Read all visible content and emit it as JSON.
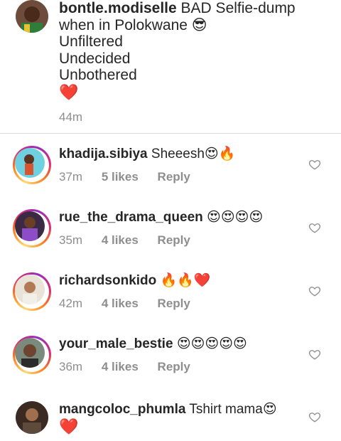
{
  "post": {
    "username": "bontle.modiselle",
    "caption_first": "BAD Selfie-dump",
    "caption_second": "when in Polokwane",
    "caption_second_emoji": "😎",
    "lines": [
      "Unfiltered",
      "Undecided",
      "Unbothered"
    ],
    "heart": "❤️",
    "time": "44m"
  },
  "comments": [
    {
      "username": "khadija.sibiya",
      "text": "Sheeesh",
      "emoji": "😍🔥",
      "time": "37m",
      "likes": "5 likes",
      "reply": "Reply"
    },
    {
      "username": "rue_the_drama_queen",
      "text": "",
      "emoji": "😍😍😍😍",
      "time": "35m",
      "likes": "4 likes",
      "reply": "Reply"
    },
    {
      "username": "richardsonkido",
      "text": "",
      "emoji": "🔥🔥❤️",
      "time": "42m",
      "likes": "4 likes",
      "reply": "Reply"
    },
    {
      "username": "your_male_bestie",
      "text": "",
      "emoji": "😍😍😍😍😍",
      "time": "36m",
      "likes": "4 likes",
      "reply": "Reply"
    },
    {
      "username": "mangcoloc_phumla",
      "text": "Tshirt mama",
      "emoji": "😍",
      "second_line": "❤️"
    }
  ],
  "colors": {
    "text": "#262626",
    "meta": "#8e8e8e",
    "divider": "#dbdbdb",
    "heart": "#e0263b"
  },
  "icons": {
    "like": "heart-outline-icon"
  }
}
